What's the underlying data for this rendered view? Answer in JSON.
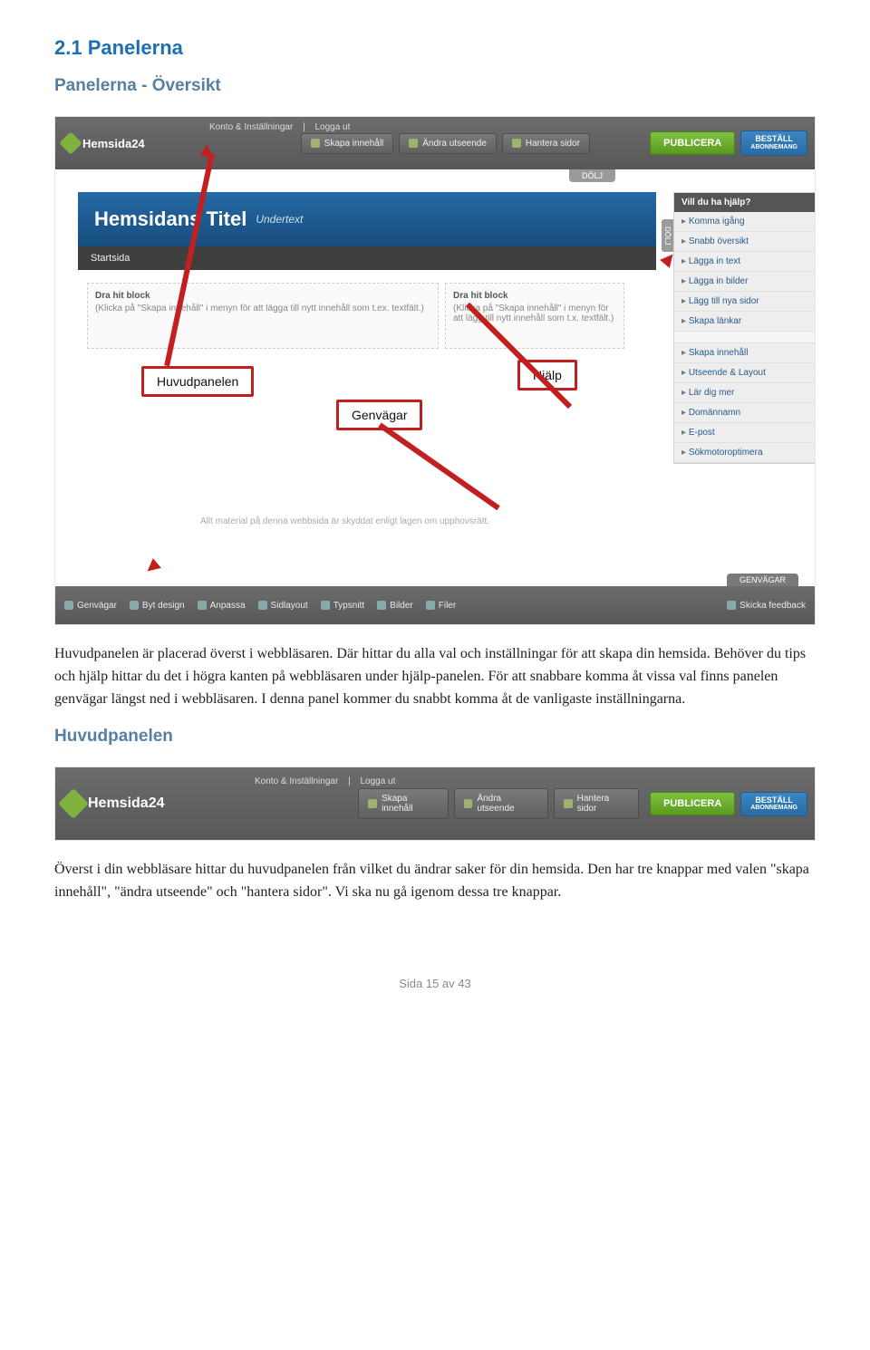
{
  "heading_section": "2.1 Panelerna",
  "subheading1": "Panelerna - Översikt",
  "subheading2": "Huvudpanelen",
  "para1": "Huvudpanelen är placerad överst i webbläsaren. Där hittar du alla val och inställningar för att skapa din hemsida. Behöver du tips och hjälp hittar du det i högra kanten på webbläsaren under hjälp-panelen. För att snabbare komma åt vissa val finns panelen genvägar längst ned i webbläsaren. I denna panel kommer du snabbt komma åt de vanligaste inställningarna.",
  "para2": "Överst i din webbläsare hittar du huvudpanelen från vilket du ändrar saker för din hemsida. Den har tre knappar med valen \"skapa innehåll\", \"ändra utseende\" och \"hantera sidor\". Vi ska nu gå igenom dessa tre knappar.",
  "page_footer": "Sida 15 av 43",
  "screenshot": {
    "logo": "Hemsida24",
    "smalllink1": "Konto & Inställningar",
    "smalllink2": "Logga ut",
    "btn_skapa": "Skapa innehåll",
    "btn_andra": "Ändra utseende",
    "btn_hantera": "Hantera sidor",
    "btn_publicera": "PUBLICERA",
    "btn_bestall_line1": "BESTÄLL",
    "btn_bestall_line2": "ABONNEMANG",
    "dolj": "DÖLJ",
    "title_big": "Hemsidans Titel",
    "title_sub": "Undertext",
    "nav_start": "Startsida",
    "help_header": "Vill du ha hjälp?",
    "help1": "Komma igång",
    "help2": "Snabb översikt",
    "help3": "Lägga in text",
    "help4": "Lägga in bilder",
    "help5": "Lägg till nya sidor",
    "help6": "Skapa länkar",
    "help7": "Skapa innehåll",
    "help8": "Utseende & Layout",
    "help9": "Lär dig mer",
    "help10": "Domännamn",
    "help11": "E-post",
    "help12": "Sökmotoroptimera",
    "dz_title": "Dra hit block",
    "dz1_text": "(Klicka på \"Skapa innehåll\" i menyn för att lägga till nytt innehåll som t.ex. textfält.)",
    "dz2_text": "(Klicka på \"Skapa innehåll\" i menyn för att lägg till nytt innehåll som t.x. textfält.)",
    "callout1": "Huvudpanelen",
    "callout2": "Genvägar",
    "callout3": "Hjälp",
    "footer_copy": "Allt material på denna webbsida är skyddat enligt lagen om upphovsrätt.",
    "genvagar_tab": "GENVÄGAR",
    "bot1": "Genvägar",
    "bot2": "Byt design",
    "bot3": "Anpassa",
    "bot4": "Sidlayout",
    "bot5": "Typsnitt",
    "bot6": "Bilder",
    "bot7": "Filer",
    "bot8": "Skicka feedback"
  }
}
